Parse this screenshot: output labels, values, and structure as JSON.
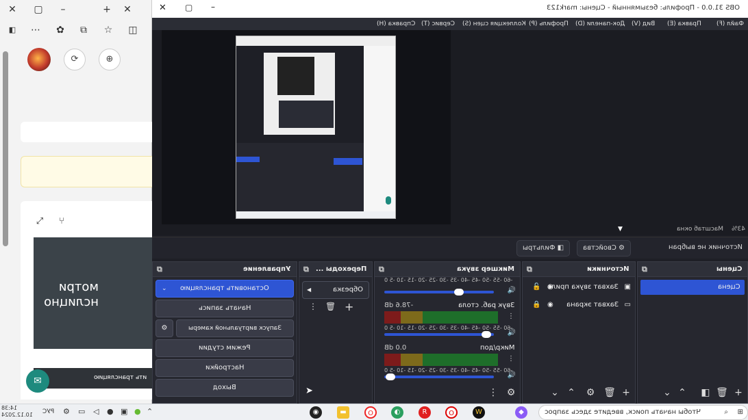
{
  "browser": {
    "window_buttons": [
      "✕",
      "▢",
      "–",
      "+",
      "✕"
    ],
    "dark_card_text": "мотри\nнслицно",
    "dark_card2_text": "ить трансляцию"
  },
  "obs": {
    "title": "OBS 31.0.0 - Профиль: безымянный - Сцены: mark123",
    "menu": [
      "Файл (F)",
      "Правка (E)",
      "Вид (V)",
      "Док-панели (D)",
      "Профиль (P)",
      "Коллекция сцен (S)",
      "Сервис (T)",
      "Справка (H)"
    ],
    "zoom": "43%",
    "zoom_label": "Масштаб окна",
    "source_bar": {
      "no_source": "Источник не выбран",
      "properties": "Свойства",
      "filters": "Фильтры"
    },
    "scenes": {
      "title": "Сцены",
      "items": [
        "Сцена"
      ]
    },
    "sources": {
      "title": "Источники",
      "items": [
        "Захват звука прило",
        "Захват экрана"
      ]
    },
    "mixer": {
      "title": "Микшер звука",
      "channels": [
        {
          "name": "Звук раб. стола",
          "db": "-78.6 dB"
        },
        {
          "name": "Микр/доп",
          "db": "0.0 dB"
        }
      ],
      "ticks": "-60 -55 -50 -45 -40 -35 -30 -25 -20 -15 -10 -5 0"
    },
    "transitions": {
      "title": "Переходы ...",
      "selected": "Обрезка"
    },
    "controls": {
      "title": "Управление",
      "stop_stream": "Остановить трансляцию",
      "start_record": "Начать запись",
      "virtual_cam": "Запуск виртуальной камеры",
      "studio_mode": "Режим студии",
      "settings": "Настройки",
      "exit": "Выход"
    }
  },
  "taskbar": {
    "search_placeholder": "Чтобы начать поиск, введите здесь запрос",
    "lang": "РУС",
    "time": "14:38",
    "date": "10.12.2024"
  },
  "colors": {
    "obs_accent": "#2e55d4",
    "obs_bg": "#1e1f26"
  }
}
